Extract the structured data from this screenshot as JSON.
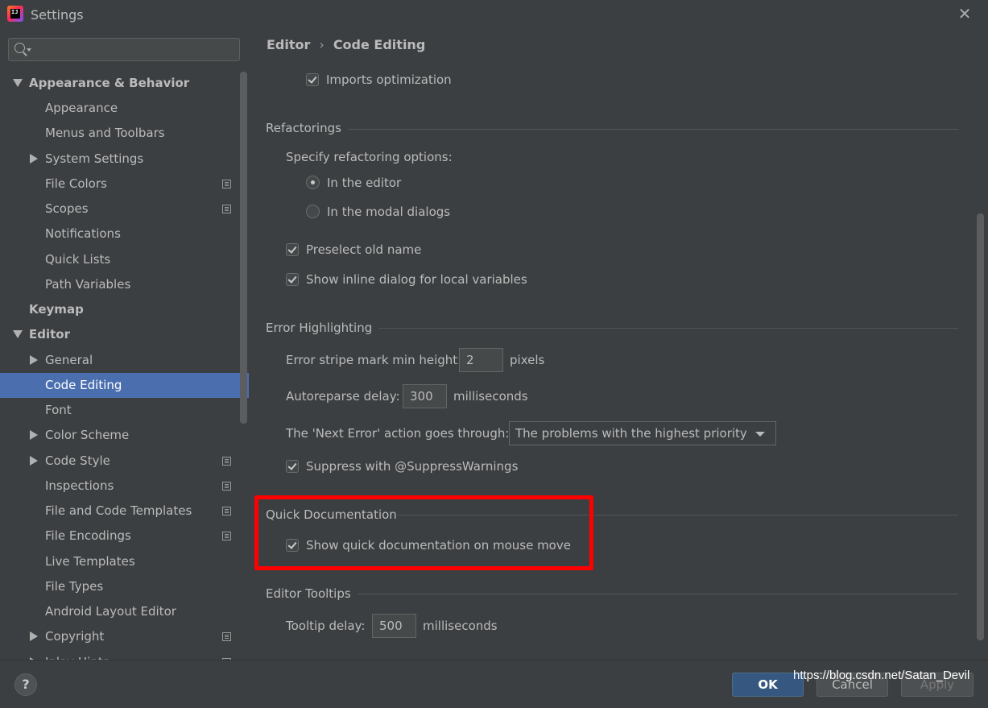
{
  "window": {
    "title": "Settings",
    "close_icon": "close-icon"
  },
  "sidebar": {
    "search_placeholder": "",
    "items": [
      {
        "label": "Appearance & Behavior"
      },
      {
        "label": "Appearance"
      },
      {
        "label": "Menus and Toolbars"
      },
      {
        "label": "System Settings"
      },
      {
        "label": "File Colors"
      },
      {
        "label": "Scopes"
      },
      {
        "label": "Notifications"
      },
      {
        "label": "Quick Lists"
      },
      {
        "label": "Path Variables"
      },
      {
        "label": "Keymap"
      },
      {
        "label": "Editor"
      },
      {
        "label": "General"
      },
      {
        "label": "Code Editing"
      },
      {
        "label": "Font"
      },
      {
        "label": "Color Scheme"
      },
      {
        "label": "Code Style"
      },
      {
        "label": "Inspections"
      },
      {
        "label": "File and Code Templates"
      },
      {
        "label": "File Encodings"
      },
      {
        "label": "Live Templates"
      },
      {
        "label": "File Types"
      },
      {
        "label": "Android Layout Editor"
      },
      {
        "label": "Copyright"
      },
      {
        "label": "Inlay Hints"
      }
    ]
  },
  "breadcrumb": {
    "parent": "Editor",
    "separator": "›",
    "current": "Code Editing"
  },
  "content": {
    "imports_optimization": {
      "label": "Imports optimization",
      "checked": true
    },
    "refactorings": {
      "title": "Refactorings",
      "specify_label": "Specify refactoring options:",
      "radio_editor": {
        "label": "In the editor",
        "selected": true
      },
      "radio_modal": {
        "label": "In the modal dialogs",
        "selected": false
      },
      "preselect": {
        "label": "Preselect old name",
        "checked": true
      },
      "inline_dialog": {
        "label": "Show inline dialog for local variables",
        "checked": true
      }
    },
    "error_highlighting": {
      "title": "Error Highlighting",
      "stripe_label": "Error stripe mark min height:",
      "stripe_value": "2",
      "stripe_unit": "pixels",
      "autoreparse_label": "Autoreparse delay:",
      "autoreparse_value": "300",
      "autoreparse_unit": "milliseconds",
      "next_error_label": "The 'Next Error' action goes through:",
      "next_error_value": "The problems with the highest priority",
      "suppress": {
        "label": "Suppress with @SuppressWarnings",
        "checked": true
      }
    },
    "quick_documentation": {
      "title": "Quick Documentation",
      "show_on_mouse_move": {
        "label": "Show quick documentation on mouse move",
        "checked": true
      },
      "highlight_color": "#ff0000"
    },
    "editor_tooltips": {
      "title": "Editor Tooltips",
      "delay_label": "Tooltip delay:",
      "delay_value": "500",
      "delay_unit": "milliseconds"
    }
  },
  "footer": {
    "help_label": "?",
    "ok_label": "OK",
    "cancel_label": "Cancel",
    "apply_label": "Apply",
    "watermark": "https://blog.csdn.net/Satan_Devil"
  },
  "colors": {
    "background": "#3c3f41",
    "selection": "#4b6eaf",
    "primary_button": "#365880"
  }
}
